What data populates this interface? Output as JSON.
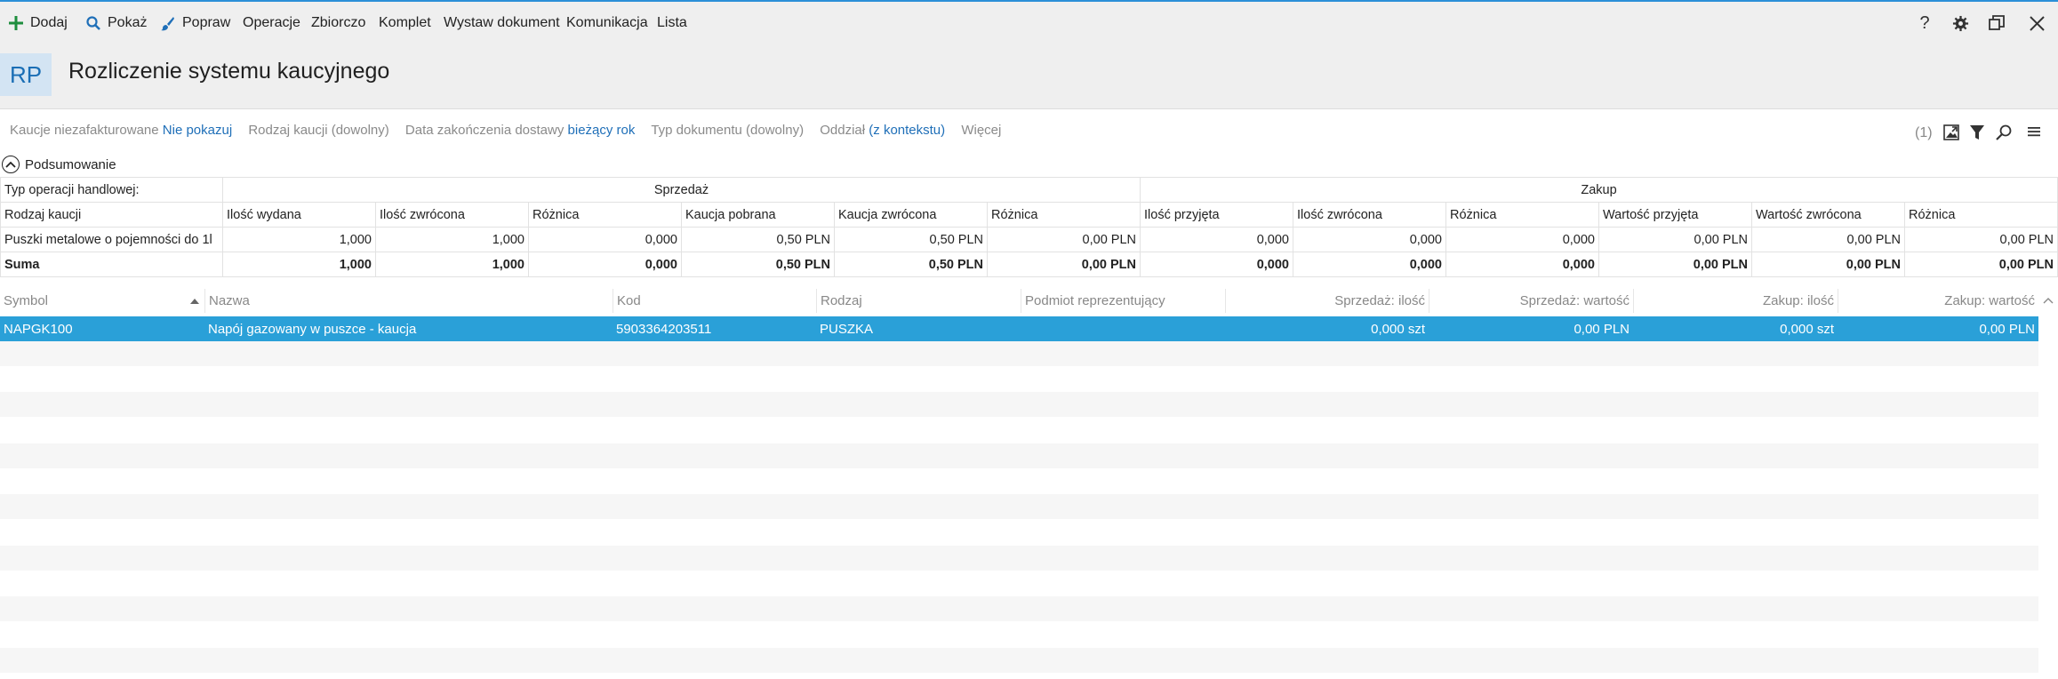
{
  "toolbar": {
    "add_label": "Dodaj",
    "show_label": "Pokaż",
    "edit_label": "Popraw",
    "operations_label": "Operacje",
    "bulk_label": "Zbiorczo",
    "set_label": "Komplet",
    "issue_doc_label": "Wystaw dokument",
    "comm_label": "Komunikacja",
    "list_label": "Lista",
    "help_glyph": "?"
  },
  "header": {
    "badge": "RP",
    "title": "Rozliczenie systemu kaucyjnego"
  },
  "filters": {
    "uninvoiced_label": "Kaucje niezafakturowane",
    "uninvoiced_value": "Nie pokazuj",
    "deposit_type_label": "Rodzaj kaucji (dowolny)",
    "delivery_end_label": "Data zakończenia dostawy",
    "delivery_end_value": "bieżący rok",
    "doc_type_label": "Typ dokumentu (dowolny)",
    "branch_label": "Oddział",
    "branch_value": "(z kontekstu)",
    "more_label": "Więcej",
    "count": "(1)"
  },
  "summary": {
    "toggle_label": "Podsumowanie",
    "op_type_label": "Typ operacji handlowej:",
    "sales_group": "Sprzedaż",
    "purchase_group": "Zakup",
    "columns": [
      "Rodzaj kaucji",
      "Ilość wydana",
      "Ilość zwrócona",
      "Różnica",
      "Kaucja pobrana",
      "Kaucja zwrócona",
      "Różnica",
      "Ilość przyjęta",
      "Ilość zwrócona",
      "Różnica",
      "Wartość przyjęta",
      "Wartość zwrócona",
      "Różnica"
    ],
    "row": [
      "Puszki metalowe o pojemności do 1l",
      "1,000",
      "1,000",
      "0,000",
      "0,50 PLN",
      "0,50 PLN",
      "0,00 PLN",
      "0,000",
      "0,000",
      "0,000",
      "0,00 PLN",
      "0,00 PLN",
      "0,00 PLN"
    ],
    "total": [
      "Suma",
      "1,000",
      "1,000",
      "0,000",
      "0,50 PLN",
      "0,50 PLN",
      "0,00 PLN",
      "0,000",
      "0,000",
      "0,000",
      "0,00 PLN",
      "0,00 PLN",
      "0,00 PLN"
    ]
  },
  "grid": {
    "columns": [
      "Symbol",
      "Nazwa",
      "Kod",
      "Rodzaj",
      "Podmiot reprezentujący",
      "Sprzedaż: ilość",
      "Sprzedaż: wartość",
      "Zakup: ilość",
      "Zakup: wartość"
    ],
    "rows": [
      [
        "NAPGK100",
        "Napój gazowany w puszce - kaucja",
        "5903364203511",
        "PUSZKA",
        "",
        "0,000 szt",
        "0,00 PLN",
        "0,000 szt",
        "0,00 PLN"
      ]
    ]
  },
  "colors": {
    "accent": "#2b8fd8",
    "selected_row": "#2aa0d8",
    "link": "#1f6fb8",
    "add_icon": "#1e8e3e"
  }
}
